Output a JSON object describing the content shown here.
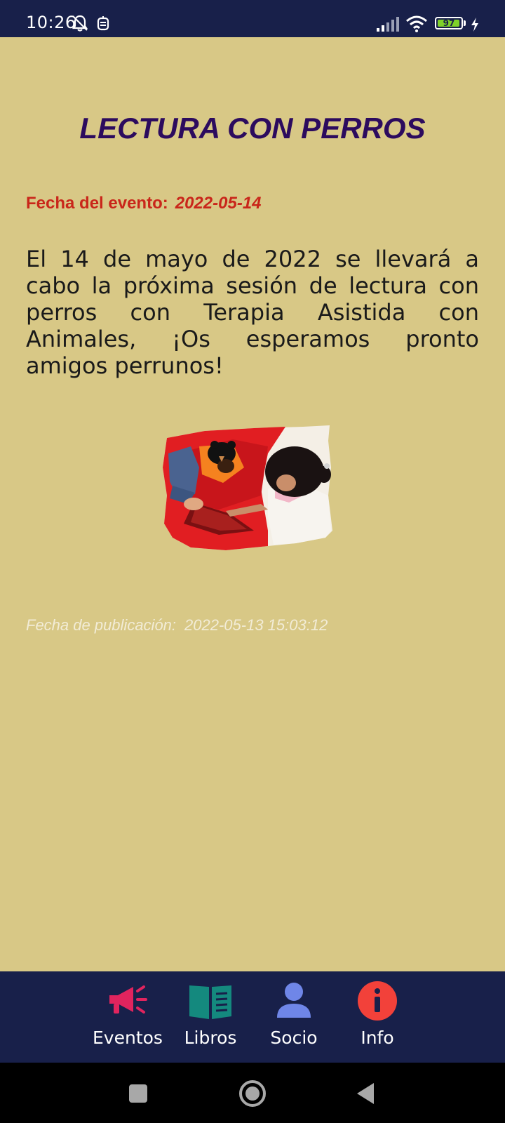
{
  "status_bar": {
    "time": "10:26",
    "battery_level": "97",
    "battery_fraction": 0.97,
    "icons": [
      "bell-off-icon",
      "device-icon",
      "signal-icon",
      "wifi-icon",
      "battery-icon",
      "charging-icon"
    ]
  },
  "event": {
    "title": "LECTURA CON PERROS",
    "date_label": "Fecha del evento:",
    "date_value": "2022-05-14",
    "description": "El 14 de mayo de 2022 se llevará a cabo la próxima sesión de lectura con perros con Terapia Asistida con Animales, ¡Os esperamos pronto amigos perrunos!",
    "publication_label": "Fecha de publicación:",
    "publication_value": "2022-05-13 15:03:12"
  },
  "bottom_nav": {
    "items": [
      {
        "label": "Eventos",
        "icon": "megaphone-icon",
        "color": "#e0245e"
      },
      {
        "label": "Libros",
        "icon": "book-icon",
        "color": "#14897e"
      },
      {
        "label": "Socio",
        "icon": "person-icon",
        "color": "#6f86e8"
      },
      {
        "label": "Info",
        "icon": "info-icon",
        "color": "#f2413a"
      }
    ]
  },
  "system_nav": {
    "buttons": [
      "recents-button",
      "home-button",
      "back-button"
    ]
  },
  "colors": {
    "background": "#d8c886",
    "bars": "#18204a",
    "title": "#2c0b5e",
    "date": "#c9261a"
  }
}
